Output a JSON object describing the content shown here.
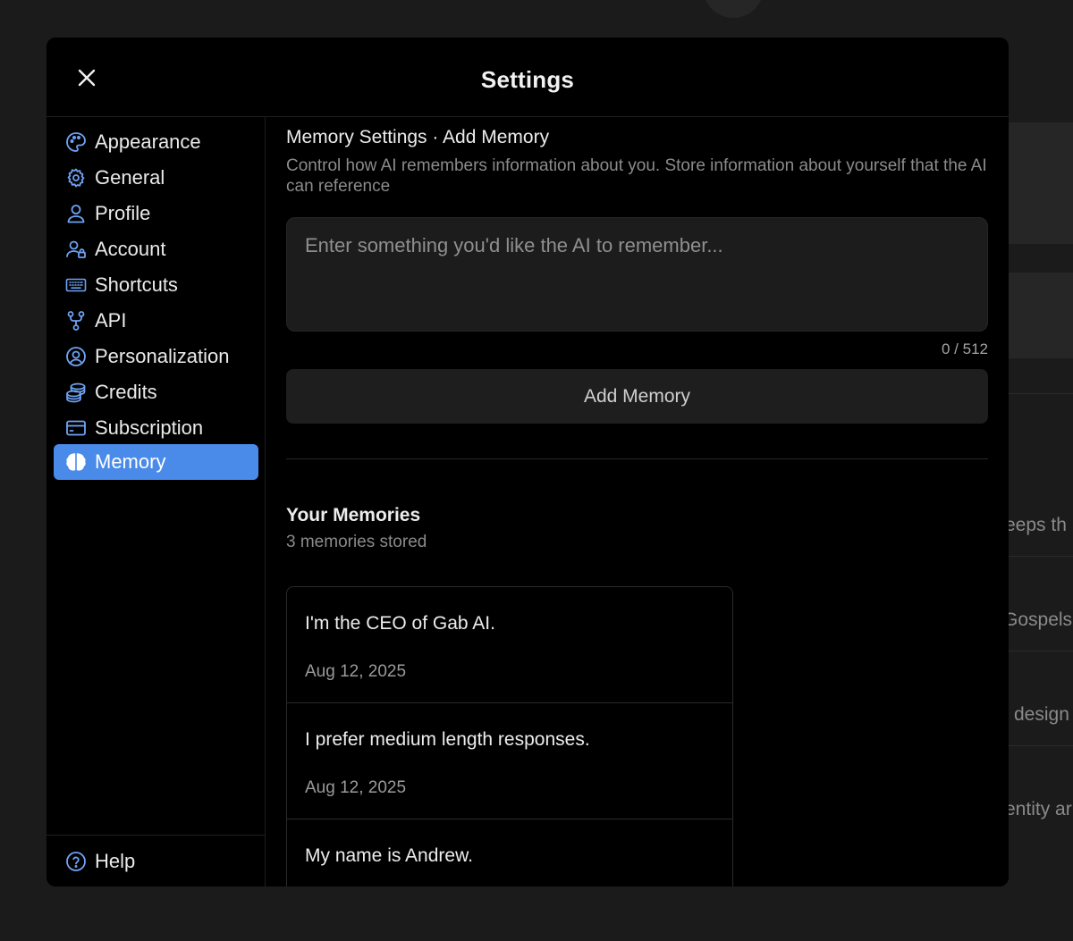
{
  "modal": {
    "title": "Settings"
  },
  "sidebar": {
    "items": [
      {
        "label": "Appearance",
        "icon": "palette-icon",
        "active": false
      },
      {
        "label": "General",
        "icon": "gear-icon",
        "active": false
      },
      {
        "label": "Profile",
        "icon": "user-icon",
        "active": false
      },
      {
        "label": "Account",
        "icon": "user-lock-icon",
        "active": false
      },
      {
        "label": "Shortcuts",
        "icon": "keyboard-icon",
        "active": false
      },
      {
        "label": "API",
        "icon": "git-fork-icon",
        "active": false
      },
      {
        "label": "Personalization",
        "icon": "user-circle-icon",
        "active": false
      },
      {
        "label": "Credits",
        "icon": "coins-icon",
        "active": false
      },
      {
        "label": "Subscription",
        "icon": "credit-card-icon",
        "active": false
      },
      {
        "label": "Memory",
        "icon": "brain-icon",
        "active": true
      }
    ],
    "help": {
      "label": "Help",
      "icon": "help-circle-icon"
    }
  },
  "memory": {
    "section_title": "Memory Settings · Add Memory",
    "description": "Control how AI remembers information about you. Store information about yourself that the AI can reference",
    "input_placeholder": "Enter something you'd like the AI to remember...",
    "char_count": "0 / 512",
    "add_button_label": "Add Memory",
    "list_title": "Your Memories",
    "list_count": "3 memories stored",
    "items": [
      {
        "text": "I'm the CEO of Gab AI.",
        "date": "Aug 12, 2025"
      },
      {
        "text": "I prefer medium length responses.",
        "date": "Aug 12, 2025"
      },
      {
        "text": "My name is Andrew.",
        "date": ""
      }
    ]
  },
  "background": {
    "snippets": [
      "eeps th",
      "Gospels",
      "design",
      "entity ar"
    ]
  },
  "colors": {
    "accent": "#4a8bea",
    "icon": "#6fa3f5",
    "modal_bg": "#000000",
    "page_bg": "#1b1b1b"
  }
}
